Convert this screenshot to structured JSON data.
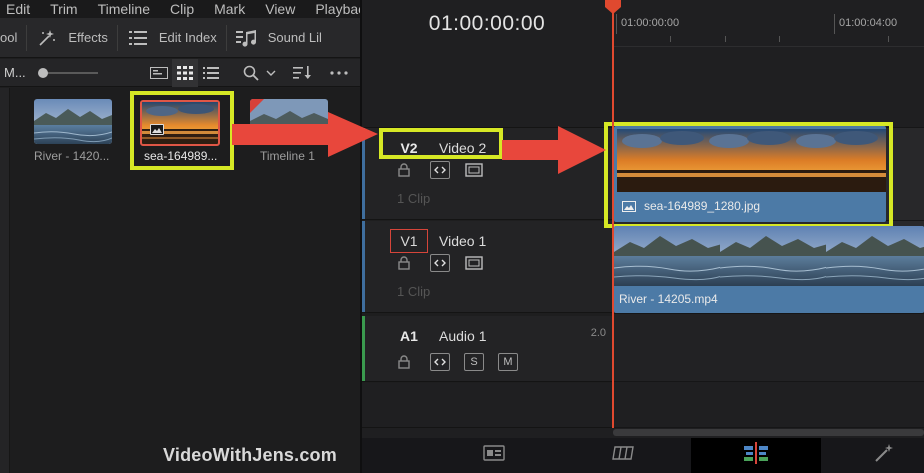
{
  "menu": [
    "Edit",
    "Trim",
    "Timeline",
    "Clip",
    "Mark",
    "View",
    "Playback"
  ],
  "toolbar": {
    "pool_label": "ool",
    "effects_label": "Effects",
    "edit_index_label": "Edit Index",
    "sound_library_label": "Sound Lil"
  },
  "pool_header": {
    "m_label": "M..."
  },
  "clips": [
    {
      "label": "River - 1420...",
      "icon": "video-clip-icon"
    },
    {
      "label": "sea-164989...",
      "icon": "image-icon"
    },
    {
      "label": "Timeline 1",
      "icon": "timeline-icon"
    }
  ],
  "watermark": "VideoWithJens.com",
  "timeline": {
    "timecode": "01:00:00:00",
    "ruler_labels": [
      "01:00:00:00",
      "01:00:04:00"
    ],
    "tracks": [
      {
        "code": "V2",
        "name": "Video 2",
        "sub": "1 Clip"
      },
      {
        "code": "V1",
        "name": "Video 1",
        "sub": "1 Clip"
      },
      {
        "code": "A1",
        "name": "Audio 1",
        "sub": "",
        "channels": "2.0"
      }
    ],
    "audio_buttons": [
      "S",
      "M"
    ],
    "clip_v2_name": "sea-164989_1280.jpg",
    "clip_v1_name": "River - 14205.mp4"
  },
  "colors": {
    "highlight": "#d6e825",
    "arrow": "#e8473c",
    "playhead": "#e0492f",
    "video_track_bar": "#3f6e9e",
    "audio_track_bar": "#3a9a4e",
    "clip_label_bar": "#4c7aa6"
  }
}
